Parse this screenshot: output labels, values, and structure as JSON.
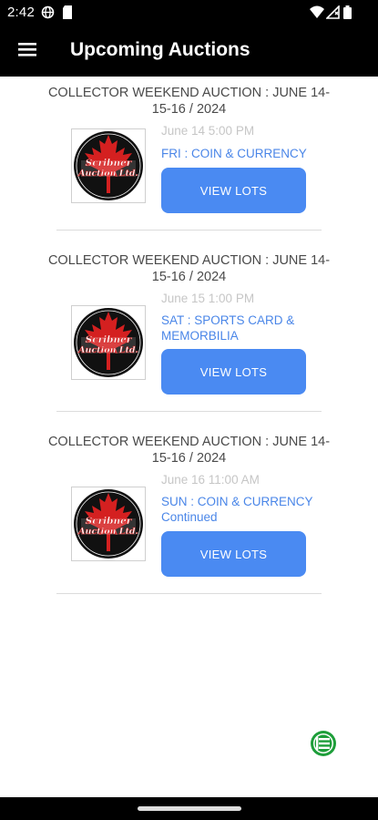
{
  "status_bar": {
    "time": "2:42",
    "icons": [
      "vpn-globe-icon",
      "sim-card-icon",
      "wifi-icon",
      "signal-icon",
      "battery-icon"
    ]
  },
  "app_bar": {
    "menu_icon": "hamburger-menu-icon",
    "title": "Upcoming Auctions"
  },
  "auctions": [
    {
      "title": "COLLECTOR WEEKEND AUCTION : JUNE 14-15-16 / 2024",
      "date": "June 14 5:00 PM",
      "description": "FRI : COIN & CURRENCY",
      "button_label": "VIEW LOTS",
      "logo": "scribner-auction-logo"
    },
    {
      "title": "COLLECTOR WEEKEND AUCTION : JUNE 14-15-16 / 2024",
      "date": "June 15 1:00 PM",
      "description": "SAT : SPORTS CARD & MEMORBILIA",
      "button_label": "VIEW LOTS",
      "logo": "scribner-auction-logo"
    },
    {
      "title": "COLLECTOR WEEKEND AUCTION : JUNE 14-15-16 / 2024",
      "date": "June 16 11:00 AM",
      "description": "SUN : COIN & CURRENCY Continued",
      "button_label": "VIEW LOTS",
      "logo": "scribner-auction-logo"
    }
  ],
  "logo_text": {
    "line1": "Scribner",
    "line2": "Auction Ltd."
  },
  "fab_icon": "green-list-icon",
  "colors": {
    "bar": "#000000",
    "accent": "#4a8af2",
    "link": "#4a86e8",
    "date": "#c6c6c6",
    "fab": "#1e9e3a"
  }
}
